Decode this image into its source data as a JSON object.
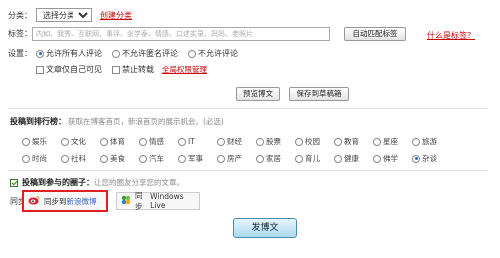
{
  "category": {
    "label": "分类：",
    "selected": "选择分类",
    "create_link": "创建分类"
  },
  "tags": {
    "label": "标签：",
    "placeholder": "内如、我秀、互联网、事评、张学泰、情感、口述实录、妈妈、老照片",
    "auto_button": "自动匹配标签",
    "help_link": "什么是标签？"
  },
  "settings": {
    "label": "设置：",
    "comment_options": [
      "允许所有人评论",
      "不允许匿名评论",
      "不允许评论"
    ],
    "selected_comment": 0,
    "self_visible": "文章仅自己可见",
    "no_repost": "禁止转载",
    "permission_link": "全局权限管理"
  },
  "actions": {
    "preview": "预览博文",
    "save_draft": "保存到草稿箱"
  },
  "rank": {
    "title": "投稿到排行榜：",
    "hint": "获取在博客首页，新浪首页的展示机会。(必选)",
    "categories": [
      "娱乐",
      "文化",
      "体育",
      "情感",
      "IT",
      "财经",
      "股票",
      "校园",
      "教育",
      "星座",
      "旅游",
      "",
      "时尚",
      "社科",
      "美食",
      "汽车",
      "军事",
      "房产",
      "家居",
      "育儿",
      "健康",
      "佛学",
      "杂谈",
      ""
    ],
    "selected": 22
  },
  "circle": {
    "title": "投稿到参与的圈子：",
    "hint": "让您的圈友分享您的文章。",
    "checked": true
  },
  "sync": {
    "label": "同步：",
    "weibo_prefix": "同步到",
    "weibo_name": "新浪微博",
    "live_prefix": "同步",
    "live_name": "Windows Live"
  },
  "publish": {
    "label": "发博文"
  },
  "colors": {
    "accent_red": "#e02020",
    "link_blue": "#3366cc",
    "publish_bg": "#a9d8ee"
  }
}
